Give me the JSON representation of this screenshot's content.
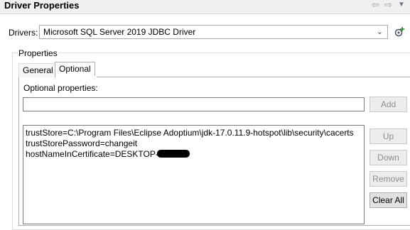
{
  "header": {
    "title": "Driver Properties",
    "back_icon": "arrow-left-icon",
    "forward_icon": "arrow-right-icon",
    "menu_icon": "chevron-down-icon"
  },
  "drivers": {
    "label": "Drivers:",
    "selected": "Microsoft SQL Server 2019 JDBC Driver",
    "add_icon": "add-driver-icon"
  },
  "properties": {
    "group_label": "Properties",
    "tabs": [
      {
        "label": "General",
        "selected": false
      },
      {
        "label": "Optional",
        "selected": true
      }
    ],
    "optional_label": "Optional properties:",
    "input_value": "",
    "list_items": [
      "trustStore=C:\\Program Files\\Eclipse Adoptium\\jdk-17.0.11.9-hotspot\\lib\\security\\cacerts",
      "trustStorePassword=changeit",
      "hostNameInCertificate=DESKTOP-"
    ],
    "buttons": {
      "add": "Add",
      "up": "Up",
      "down": "Down",
      "remove": "Remove",
      "clear_all": "Clear All"
    }
  },
  "colors": {
    "selection_border": "#adadad",
    "disabled_text": "#8e8e8e",
    "nav_icon": "#9aa4ad"
  }
}
